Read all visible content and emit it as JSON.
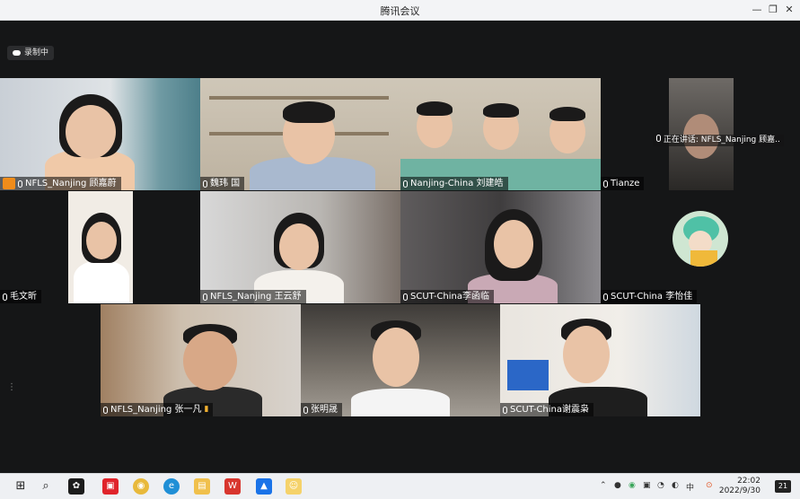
{
  "window": {
    "title": "腾讯会议",
    "minimize": "—",
    "restore": "❐",
    "close": "✕"
  },
  "recording": {
    "label": "录制中",
    "icon": "cloud-icon"
  },
  "speaking_indicator": "正在讲话: NFLS_Nanjing 顾嘉..",
  "participants": [
    {
      "name": "NFLS_Nanjing 顾嘉蔚",
      "host": true
    },
    {
      "name": "魏玮 国"
    },
    {
      "name": "Nanjing-China 刘建皓"
    },
    {
      "name": "Tianze"
    },
    {
      "name": "毛文昕"
    },
    {
      "name": "NFLS_Nanjing 王云舒"
    },
    {
      "name": "SCUT-China李函临"
    },
    {
      "name": "SCUT-China 李怡佳"
    },
    {
      "name": "NFLS_Nanjing 张一凡"
    },
    {
      "name": "张明晟"
    },
    {
      "name": "SCUT-China谢震枭"
    }
  ],
  "taskbar": {
    "time": "22:02",
    "date": "2022/9/30",
    "notifications": "21",
    "icons": [
      "windows-logo-icon",
      "search-icon",
      "app-icon",
      "news-icon",
      "chrome-icon",
      "edge-icon",
      "file-explorer-icon",
      "wps-icon",
      "tencent-meeting-icon",
      "game-icon"
    ]
  },
  "colors": {
    "accent": "#f08c1a",
    "taskbar": "#eef0f3",
    "stage": "#151617"
  }
}
